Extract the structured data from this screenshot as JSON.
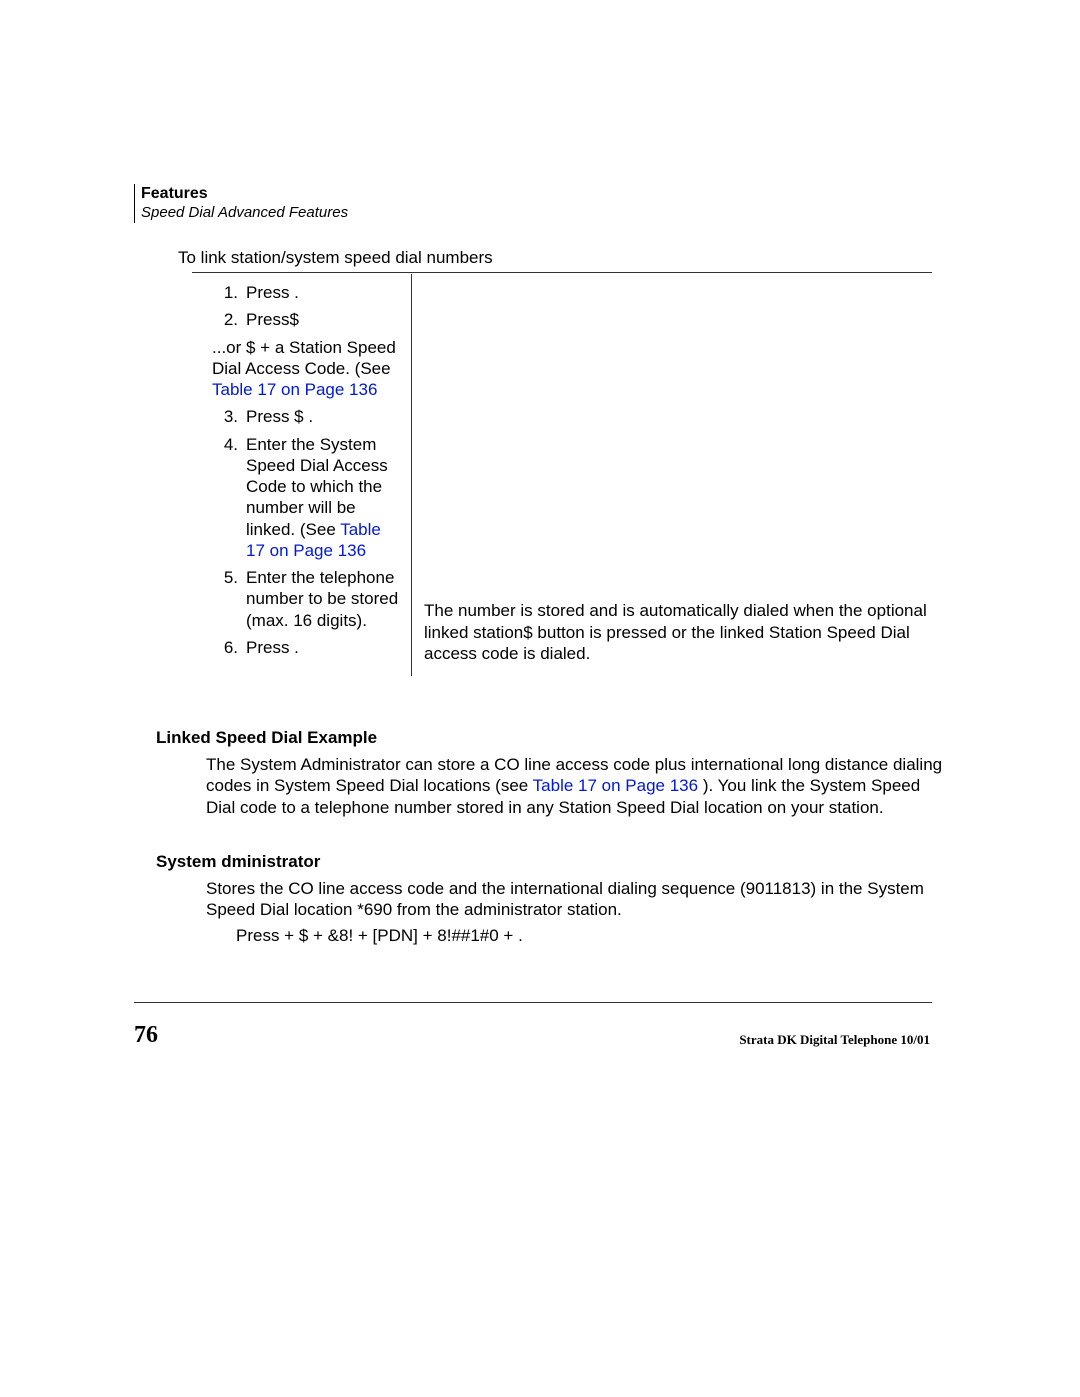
{
  "header": {
    "title": "Features",
    "subtitle": "Speed Dial  Advanced Features"
  },
  "lead": "To link station/system speed dial numbers",
  "steps": {
    "s1": {
      "num": "1.",
      "text": "Press      ."
    },
    "s2": {
      "num": "2.",
      "text": "Press$"
    },
    "or": {
      "pre": "...or     $          + a Station Speed Dial Access Code. (See",
      "link": "Table 17 on Page 136",
      "post": ""
    },
    "s3": {
      "num": "3.",
      "text": "Press    $         ."
    },
    "s4": {
      "num": "4.",
      "pre": "Enter the System Speed Dial Access Code to which the number will be linked. (See",
      "link": "Table 17 on Page 136",
      "post": ""
    },
    "s5": {
      "num": "5.",
      "text": "Enter the telephone number to be stored (max. 16 digits)."
    },
    "s6": {
      "num": "6.",
      "text": "Press       ."
    }
  },
  "rightNote": "The number is stored and is automatically dialed when the optional linked station$   button is pressed or the linked Station Speed Dial access code is dialed.",
  "example": {
    "heading": "Linked Speed Dial Example",
    "p1a": "The System Administrator can store a CO line access code plus international long distance dialing codes in System Speed Dial locations",
    "link": "Table 17 on Page 136",
    "between": " (see ",
    "p1b": "). You link the System Speed Dial code to a telephone number stored in any Station Speed Dial location on your station."
  },
  "admin": {
    "heading": "System dministrator",
    "p": "Stores the CO line access code and the international dialing sequence (9011813) in the System Speed Dial location *690 from the administrator station."
  },
  "pressLine": "Press        +    $          + &8!   + [PDN] + 8!##1#0    +        .",
  "footer": {
    "page": "76",
    "line": "Strata DK Digital Telephone  10/01"
  }
}
